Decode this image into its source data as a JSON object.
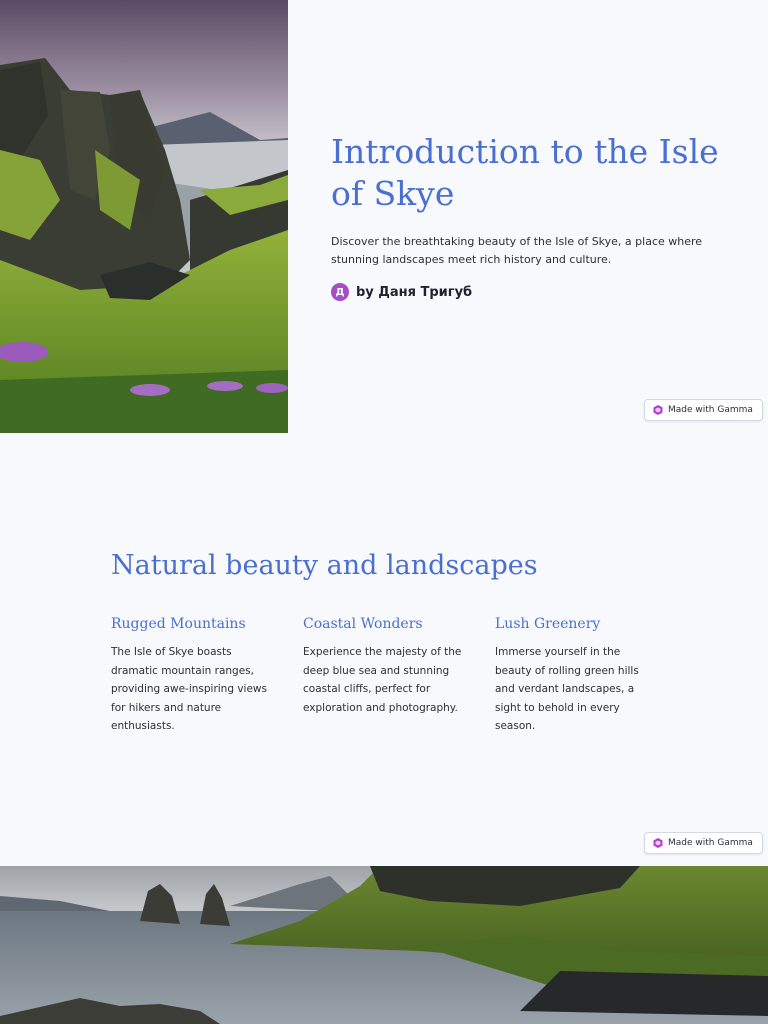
{
  "slide1": {
    "title": "Introduction to the Isle of Skye",
    "description": "Discover the breathtaking beauty of the Isle of Skye, a place where stunning landscapes meet rich history and culture.",
    "author_initial": "Д",
    "author": "by Даня Тригуб",
    "badge": "Made with Gamma"
  },
  "slide2": {
    "title": "Natural beauty and landscapes",
    "columns": [
      {
        "heading": "Rugged Mountains",
        "text": "The Isle of Skye boasts dramatic mountain ranges, providing awe-inspiring views for hikers and nature enthusiasts."
      },
      {
        "heading": "Coastal Wonders",
        "text": "Experience the majesty of the deep blue sea and stunning coastal cliffs, perfect for exploration and photography."
      },
      {
        "heading": "Lush Greenery",
        "text": "Immerse yourself in the beauty of rolling green hills and verdant landscapes, a sight to behold in every season."
      }
    ],
    "badge": "Made with Gamma"
  },
  "colors": {
    "accent": "#4a6fd0",
    "background": "#f8f9fc",
    "avatar": "#a44dcb"
  },
  "icons": {
    "badge_icon": "gamma-logo-icon"
  }
}
